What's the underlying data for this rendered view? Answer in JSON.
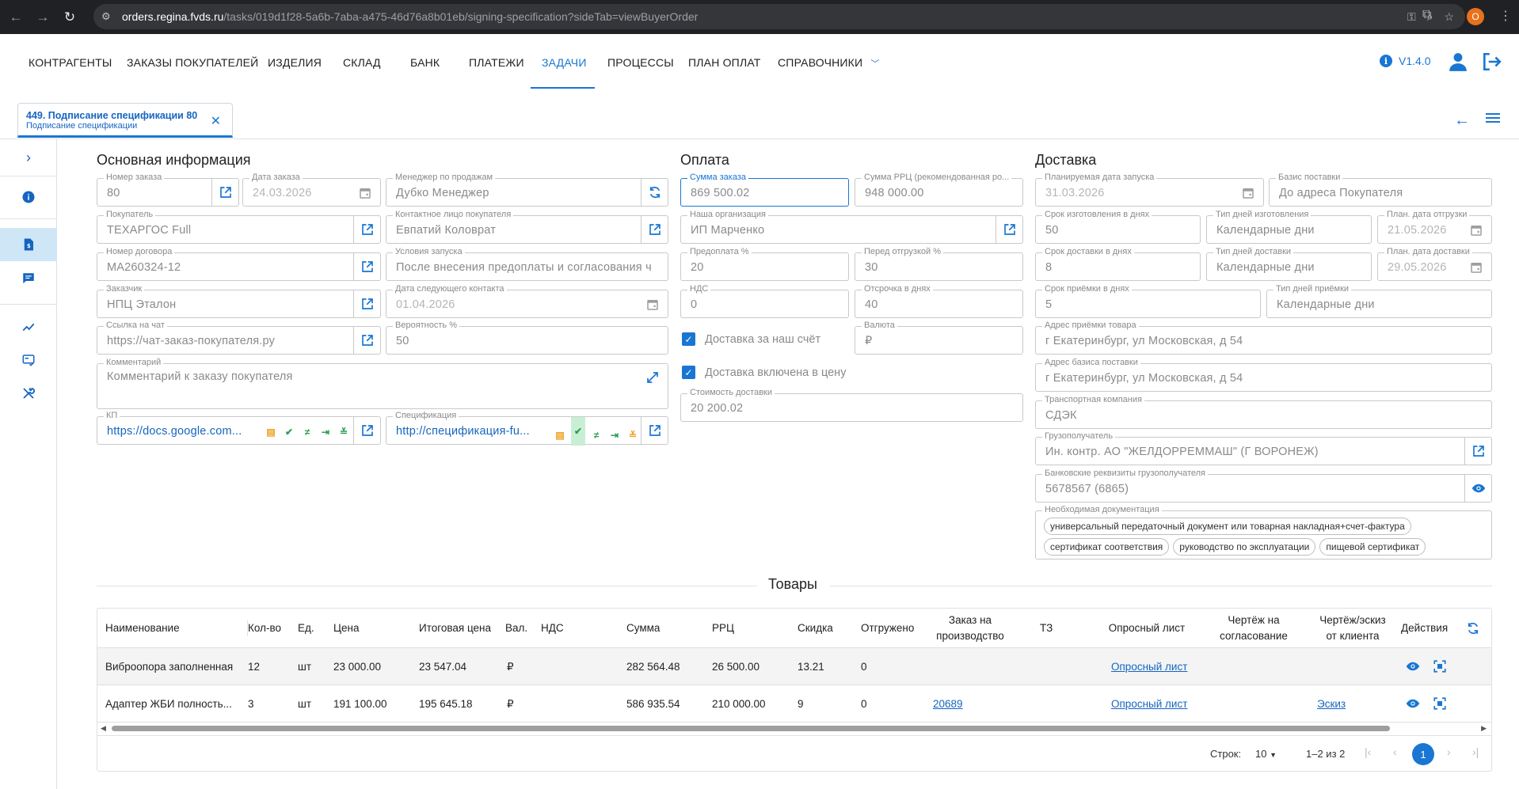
{
  "browser": {
    "url_host": "orders.regina.fvds.ru",
    "url_path": "/tasks/019d1f28-5a6b-7aba-a475-46d76a8b01eb/signing-specification?sideTab=viewBuyerOrder",
    "profile_letter": "O"
  },
  "nav": {
    "items": [
      "КОНТРАГЕНТЫ",
      "ЗАКАЗЫ ПОКУПАТЕЛЕЙ",
      "ИЗДЕЛИЯ",
      "СКЛАД",
      "БАНК",
      "ПЛАТЕЖИ",
      "ЗАДАЧИ",
      "ПРОЦЕССЫ",
      "ПЛАН ОПЛАТ",
      "СПРАВОЧНИКИ"
    ],
    "active": "ЗАДАЧИ",
    "version": "V1.4.0"
  },
  "tab": {
    "title": "449. Подписание спецификации 80",
    "subtitle": "Подписание спецификации"
  },
  "main": {
    "title": "Основная информация",
    "order_number": {
      "label": "Номер заказа",
      "value": "80"
    },
    "order_date": {
      "label": "Дата заказа",
      "value": "24.03.2026"
    },
    "sales_manager": {
      "label": "Менеджер по продажам",
      "value": "Дубко Менеджер"
    },
    "buyer": {
      "label": "Покупатель",
      "value": "ТЕХАРГОС Full"
    },
    "contact": {
      "label": "Контактное лицо покупателя",
      "value": "Евпатий Коловрат"
    },
    "contract_number": {
      "label": "Номер договора",
      "value": "МА260324-12"
    },
    "launch_conditions": {
      "label": "Условия запуска",
      "value": "После внесения предоплаты и согласования ч"
    },
    "customer": {
      "label": "Заказчик",
      "value": "НПЦ Эталон"
    },
    "next_contact_date": {
      "label": "Дата следующего контакта",
      "value": "01.04.2026"
    },
    "chat_link": {
      "label": "Ссылка на чат",
      "value": "https://чат-заказ-покупателя.ру"
    },
    "probability": {
      "label": "Вероятность %",
      "value": "50"
    },
    "comment": {
      "label": "Комментарий",
      "value": "Комментарий к заказу покупателя"
    },
    "kp": {
      "label": "КП",
      "value": "https://docs.google.com..."
    },
    "spec": {
      "label": "Спецификация",
      "value": "http://спецификация-fu..."
    }
  },
  "payment": {
    "title": "Оплата",
    "order_sum": {
      "label": "Сумма заказа",
      "value": "869 500.02"
    },
    "rrp_sum": {
      "label": "Сумма РРЦ (рекомендованная ро...",
      "value": "948 000.00"
    },
    "our_org": {
      "label": "Наша организация",
      "value": "ИП Марченко"
    },
    "prepay": {
      "label": "Предоплата %",
      "value": "20"
    },
    "before_ship": {
      "label": "Перед отгрузкой %",
      "value": "30"
    },
    "vat": {
      "label": "НДС",
      "value": "0"
    },
    "delay": {
      "label": "Отсрочка в днях",
      "value": "40"
    },
    "delivery_ours": "Доставка за наш счёт",
    "currency": {
      "label": "Валюта",
      "value": "₽"
    },
    "delivery_included": "Доставка включена в цену",
    "delivery_cost": {
      "label": "Стоимость доставки",
      "value": "20 200.02"
    }
  },
  "delivery": {
    "title": "Доставка",
    "planned_launch": {
      "label": "Планируемая дата запуска",
      "value": "31.03.2026"
    },
    "basis": {
      "label": "Базис поставки",
      "value": "До адреса Покупателя"
    },
    "make_days": {
      "label": "Срок изготовления в днях",
      "value": "50"
    },
    "make_day_type": {
      "label": "Тип дней изготовления",
      "value": "Календарные дни"
    },
    "plan_ship_date": {
      "label": "План. дата отгрузки",
      "value": "21.05.2026"
    },
    "deliv_days": {
      "label": "Срок доставки в днях",
      "value": "8"
    },
    "deliv_day_type": {
      "label": "Тип дней доставки",
      "value": "Календарные дни"
    },
    "plan_deliv_date": {
      "label": "План. дата доставки",
      "value": "29.05.2026"
    },
    "accept_days": {
      "label": "Срок приёмки в днях",
      "value": "5"
    },
    "accept_day_type": {
      "label": "Тип дней приёмки",
      "value": "Календарные дни"
    },
    "accept_address": {
      "label": "Адрес приёмки товара",
      "value": "г Екатеринбург, ул Московская, д 54"
    },
    "basis_address": {
      "label": "Адрес базиса поставки",
      "value": "г Екатеринбург, ул Московская, д 54"
    },
    "transport": {
      "label": "Транспортная компания",
      "value": "СДЭК"
    },
    "consignee": {
      "label": "Грузополучатель",
      "value": "Ин. контр. АО \"ЖЕЛДОРРЕММАШ\" (Г ВОРОНЕЖ)"
    },
    "bank": {
      "label": "Банковские реквизиты грузополучателя",
      "value": "5678567 (6865)"
    },
    "docs": {
      "label": "Необходимая документация",
      "items": [
        "универсальный передаточный документ или товарная накладная+счет-фактура",
        "сертификат соответствия",
        "руководство по эксплуатации",
        "пищевой сертификат"
      ]
    }
  },
  "products": {
    "title": "Товары",
    "headers": [
      "Наименование",
      "Кол-во",
      "Ед.",
      "Цена",
      "Итоговая цена",
      "Вал.",
      "НДС",
      "Сумма",
      "РРЦ",
      "Скидка",
      "Отгружено",
      "Заказ на производство",
      "ТЗ",
      "Опросный лист",
      "Чертёж на согласование",
      "Чертёж/эскиз от клиента",
      "Действия"
    ],
    "rows": [
      {
        "name": "Виброопора заполненная",
        "qty": "12",
        "unit": "шт",
        "price": "23 000.00",
        "final": "23 547.04",
        "cur": "₽",
        "vat": "",
        "sum": "282 564.48",
        "rrp": "26 500.00",
        "discount": "13.21",
        "shipped": "0",
        "prod_order": "",
        "tz": "",
        "survey": "Опросный лист",
        "drawing": "",
        "sketch": ""
      },
      {
        "name": "Адаптер ЖБИ полность...",
        "qty": "3",
        "unit": "шт",
        "price": "191 100.00",
        "final": "195 645.18",
        "cur": "₽",
        "vat": "",
        "sum": "586 935.54",
        "rrp": "210 000.00",
        "discount": "9",
        "shipped": "0",
        "prod_order": "20689",
        "tz": "",
        "survey": "Опросный лист",
        "drawing": "",
        "sketch": "Эскиз"
      }
    ],
    "pager": {
      "rows_label": "Строк:",
      "rows_value": "10",
      "range": "1–2 из 2",
      "page": "1"
    }
  }
}
